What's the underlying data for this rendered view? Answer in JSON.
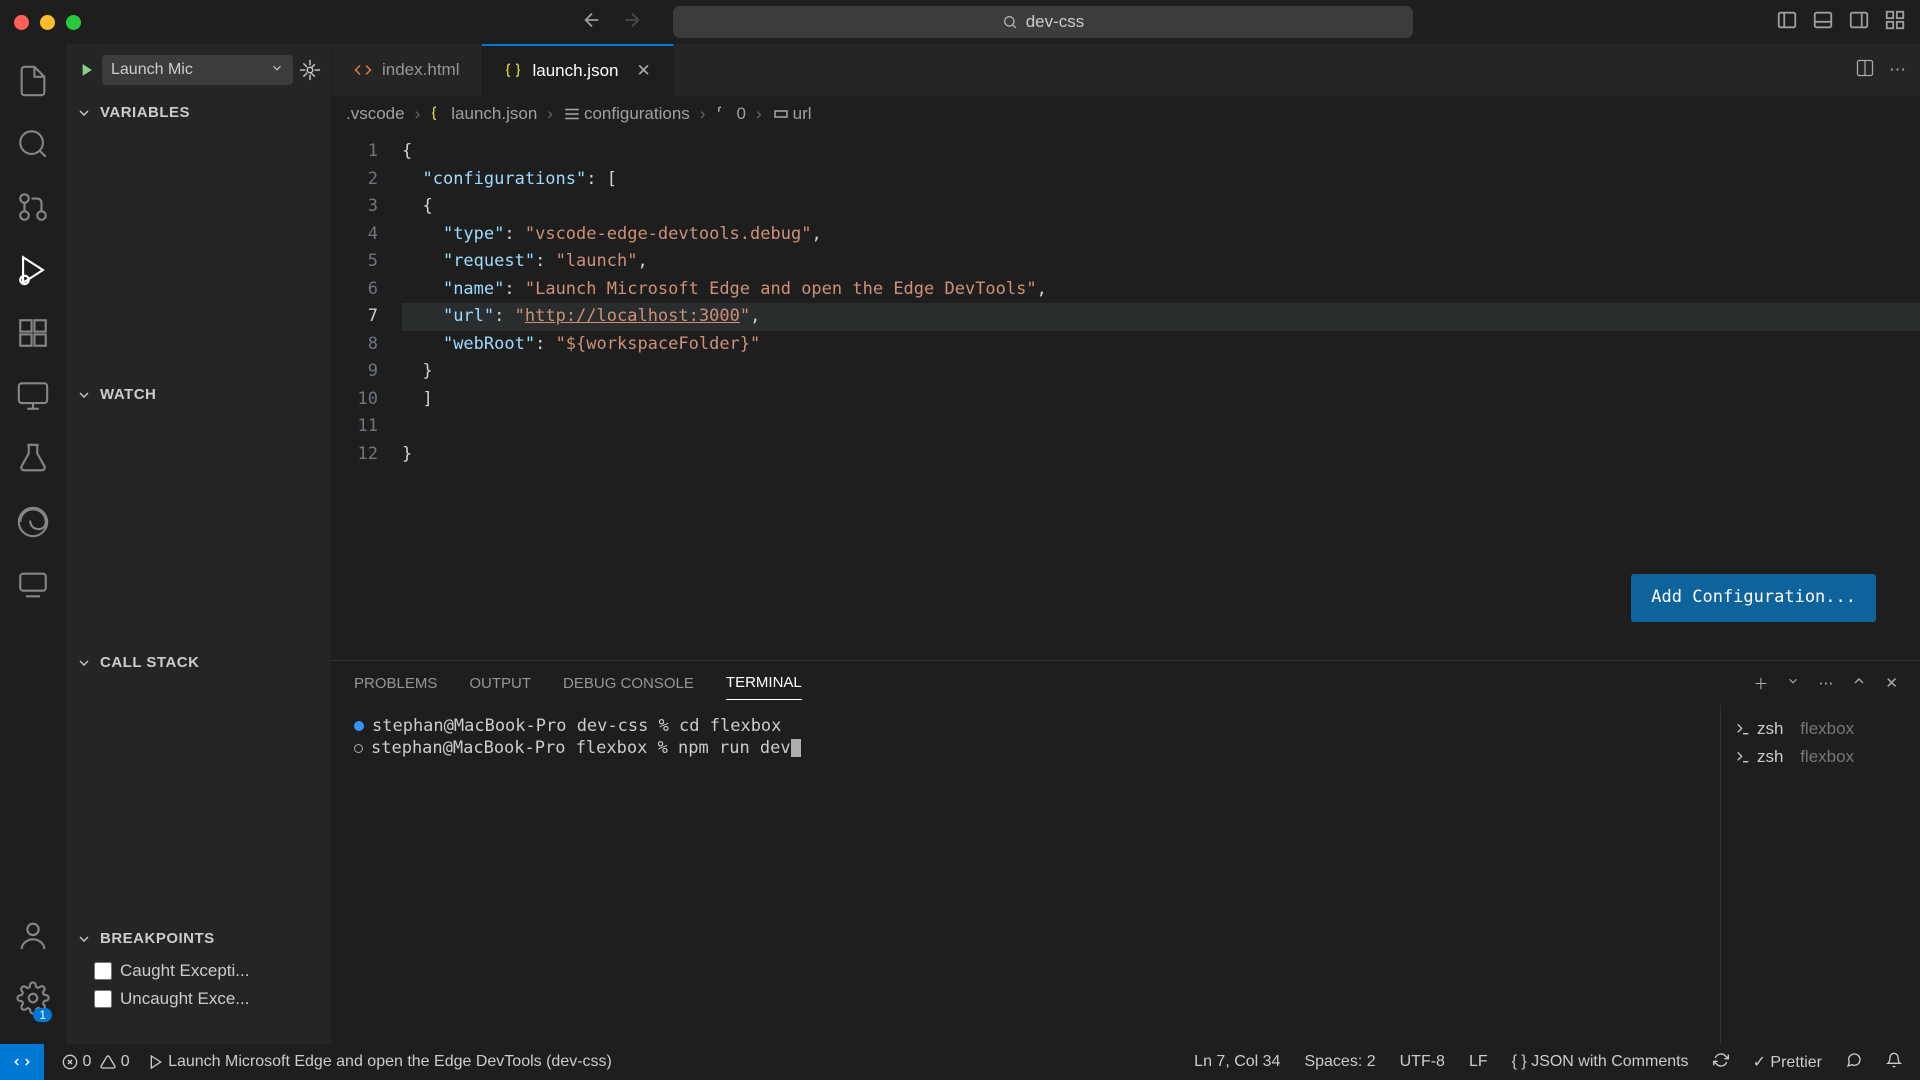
{
  "titlebar": {
    "search": "dev-css"
  },
  "run": {
    "config": "Launch Mic"
  },
  "sidebar": {
    "variables": "VARIABLES",
    "watch": "WATCH",
    "callstack": "CALL STACK",
    "breakpoints": "BREAKPOINTS",
    "bp1": "Caught Excepti...",
    "bp2": "Uncaught Exce..."
  },
  "tabs": {
    "t1": "index.html",
    "t2": "launch.json"
  },
  "breadcrumb": {
    "b1": ".vscode",
    "b2": "launch.json",
    "b3": "configurations",
    "b4": "0",
    "b5": "url"
  },
  "code": {
    "l1p": "{",
    "l2k": "\"configurations\"",
    "l2c": ": [",
    "l3p": "{",
    "l4k": "\"type\"",
    "l4c": ": ",
    "l4v": "\"vscode-edge-devtools.debug\"",
    "l4e": ",",
    "l5k": "\"request\"",
    "l5c": ": ",
    "l5v": "\"launch\"",
    "l5e": ",",
    "l6k": "\"name\"",
    "l6c": ": ",
    "l6v": "\"Launch Microsoft Edge and open the Edge DevTools\"",
    "l6e": ",",
    "l7k": "\"url\"",
    "l7c": ": ",
    "l7q": "\"",
    "l7u": "http://localhost:3000",
    "l7q2": "\"",
    "l7e": ",",
    "l8k": "\"webRoot\"",
    "l8c": ": ",
    "l8v": "\"${workspaceFolder}\"",
    "l9p": "}",
    "l10p": "]",
    "l12p": "}"
  },
  "addConfig": "Add Configuration...",
  "panel": {
    "problems": "PROBLEMS",
    "output": "OUTPUT",
    "debugconsole": "DEBUG CONSOLE",
    "terminal": "TERMINAL"
  },
  "terminal": {
    "l1p": "stephan@MacBook-Pro dev-css % ",
    "l1c": "cd flexbox",
    "l2p": "stephan@MacBook-Pro flexbox % ",
    "l2c": "npm run dev",
    "zsh": "zsh",
    "flexbox": "flexbox"
  },
  "status": {
    "err": "0",
    "warn": "0",
    "launch": "Launch Microsoft Edge and open the Edge DevTools (dev-css)",
    "ln": "Ln 7, Col 34",
    "spaces": "Spaces: 2",
    "enc": "UTF-8",
    "eol": "LF",
    "lang": "JSON with Comments",
    "prettier": "Prettier",
    "badge1": "1"
  }
}
